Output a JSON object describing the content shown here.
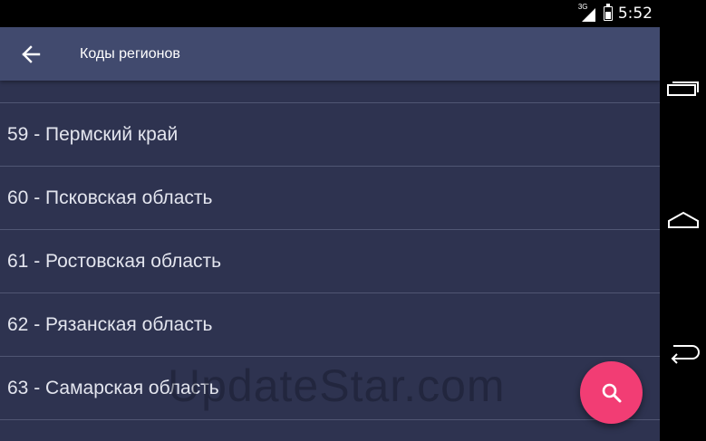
{
  "status_bar": {
    "network_label": "3G",
    "time": "5:52"
  },
  "toolbar": {
    "title": "Коды регионов"
  },
  "regions": [
    "59 - Пермский край",
    "60 - Псковская область",
    "61 - Ростовская область",
    "62 - Рязанская область",
    "63 - Самарская область"
  ],
  "watermark": "UpdateStar.com",
  "icons": {
    "back": "arrow-back-icon",
    "search": "search-icon",
    "recents": "recents-icon",
    "home": "home-icon",
    "nav_back": "nav-back-icon"
  },
  "colors": {
    "toolbar": "#414a6e",
    "background": "#2e3350",
    "fab": "#f23d74",
    "divider": "#505673",
    "text": "#e3e5ee"
  }
}
